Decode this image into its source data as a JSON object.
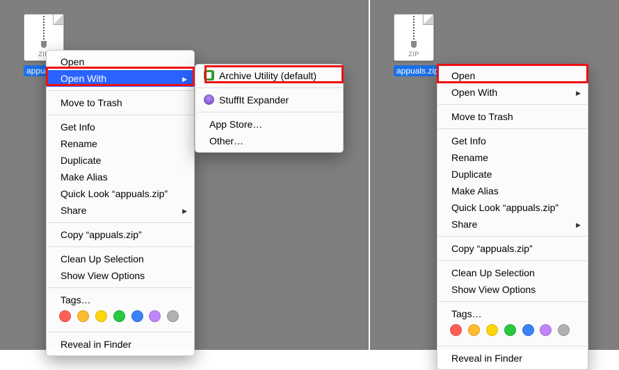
{
  "file": {
    "name": "appuals.zip",
    "ext": "ZIP"
  },
  "menu": {
    "open": "Open",
    "open_with": "Open With",
    "trash": "Move to Trash",
    "get_info": "Get Info",
    "rename": "Rename",
    "duplicate": "Duplicate",
    "make_alias": "Make Alias",
    "quick_look": "Quick Look “appuals.zip”",
    "share": "Share",
    "copy": "Copy “appuals.zip”",
    "cleanup": "Clean Up Selection",
    "view_options": "Show View Options",
    "tags": "Tags…",
    "reveal": "Reveal in Finder"
  },
  "submenu": {
    "archive_utility": "Archive Utility (default)",
    "stuffit": "StuffIt Expander",
    "app_store": "App Store…",
    "other": "Other…"
  }
}
